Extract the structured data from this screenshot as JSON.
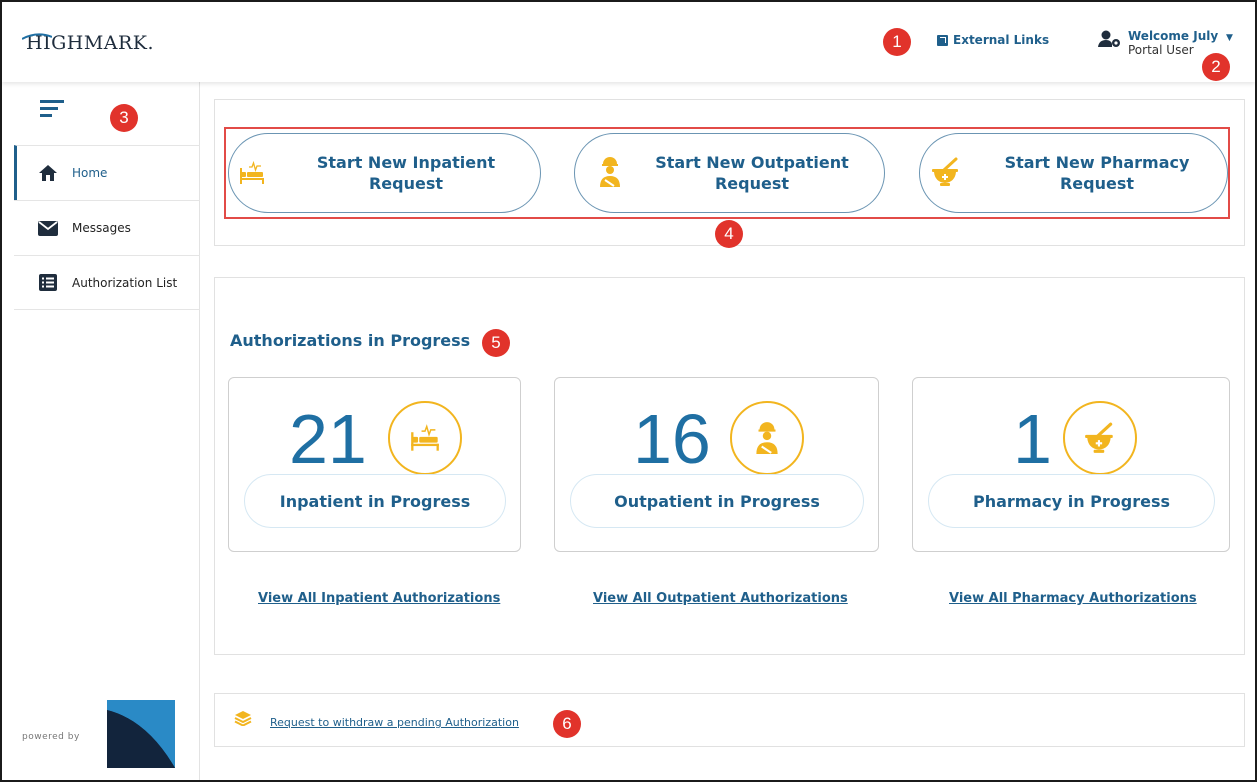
{
  "header": {
    "logo_text": "HIGHMARK.",
    "external_links_label": "External Links",
    "user_welcome": "Welcome July",
    "user_role": "Portal User"
  },
  "markers": [
    "1",
    "2",
    "3",
    "4",
    "5",
    "6"
  ],
  "sidebar": {
    "items": [
      {
        "label": "Home",
        "icon": "home-icon",
        "active": true
      },
      {
        "label": "Messages",
        "icon": "envelope-icon",
        "active": false
      },
      {
        "label": "Authorization List",
        "icon": "list-icon",
        "active": false
      }
    ],
    "powered_by": "powered by"
  },
  "requests": {
    "inpatient_label": "Start New Inpatient Request",
    "outpatient_label": "Start New Outpatient Request",
    "pharmacy_label": "Start New Pharmacy Request"
  },
  "in_progress": {
    "title": "Authorizations in Progress",
    "cards": [
      {
        "count": "21",
        "label": "Inpatient in Progress",
        "icon": "hospital-bed-icon"
      },
      {
        "count": "16",
        "label": "Outpatient in Progress",
        "icon": "outpatient-person-icon"
      },
      {
        "count": "1",
        "label": "Pharmacy in Progress",
        "icon": "mortar-pestle-icon"
      }
    ],
    "links": [
      "View All Inpatient Authorizations",
      "View All Outpatient Authorizations",
      "View All Pharmacy Authorizations"
    ]
  },
  "withdraw": {
    "label": "Request to withdraw a pending Authorization",
    "icon": "layers-icon"
  },
  "colors": {
    "primary": "#1f5f8b",
    "accent": "#f2b51f",
    "marker": "#e1332b",
    "highlight_border": "#e24b47"
  }
}
